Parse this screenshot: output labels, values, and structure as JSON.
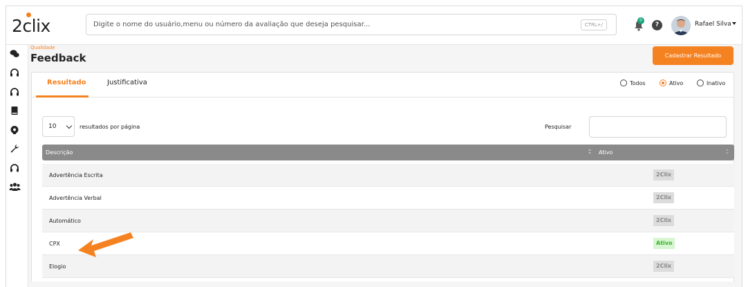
{
  "header": {
    "logo_text": "2clix",
    "search_placeholder": "Digite o nome do usuário,menu ou número da avaliação que deseja pesquisar...",
    "search_shortcut": "CTRL+/",
    "notification_count": "0",
    "help_label": "?",
    "user_name": "Rafael Silva"
  },
  "page": {
    "breadcrumb": "Qualidade",
    "title": "Feedback",
    "primary_action": "Cadastrar Resultado"
  },
  "tabs": [
    {
      "label": "Resultado",
      "active": true
    },
    {
      "label": "Justificativa",
      "active": false
    }
  ],
  "filters": [
    {
      "label": "Todos",
      "checked": false
    },
    {
      "label": "Ativo",
      "checked": true
    },
    {
      "label": "Inativo",
      "checked": false
    }
  ],
  "table": {
    "page_size": "10",
    "per_page_label": "resultados por página",
    "search_label": "Pesquisar",
    "columns": [
      "Descrição",
      "Ativo"
    ],
    "rows": [
      {
        "descricao": "Advertência Escrita",
        "status": "2Clix",
        "status_type": "gray"
      },
      {
        "descricao": "Advertência Verbal",
        "status": "2Clix",
        "status_type": "gray"
      },
      {
        "descricao": "Automático",
        "status": "2Clix",
        "status_type": "gray"
      },
      {
        "descricao": "CPX",
        "status": "Ativo",
        "status_type": "green"
      },
      {
        "descricao": "Elogio",
        "status": "2Clix",
        "status_type": "gray"
      }
    ]
  },
  "sidebar_icons": [
    "chat-icon",
    "headset-icon",
    "headset-icon",
    "book-icon",
    "brain-icon",
    "wrench-icon",
    "headset-icon",
    "users-icon"
  ],
  "colors": {
    "accent": "#f58220",
    "table_header": "#8a8a8a",
    "badge_gray": "#dcdcdc",
    "badge_green": "#d6f5d0",
    "notification": "#1aa37a"
  }
}
